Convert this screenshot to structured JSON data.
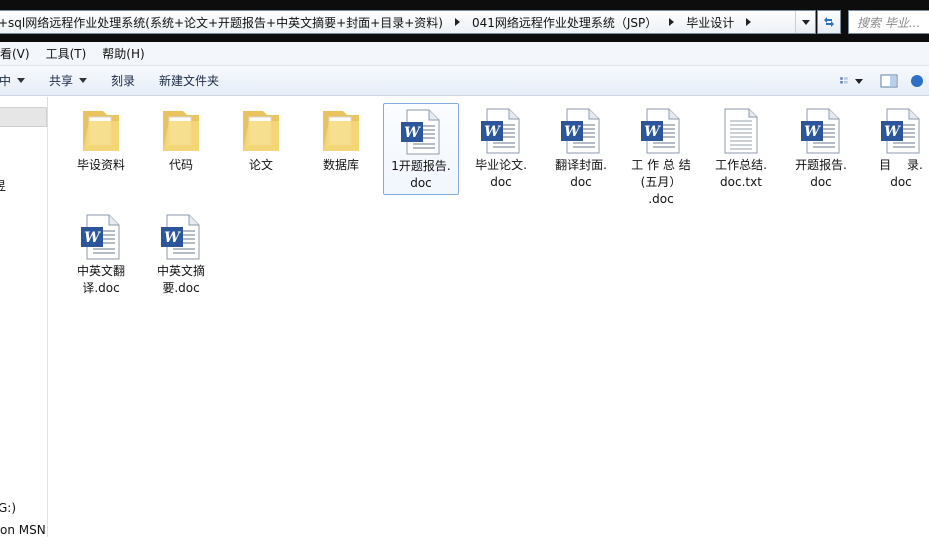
{
  "address": {
    "crumbs": [
      "+sql网络远程作业处理系统(系统+论文+开题报告+中英文摘要+封面+目录+资料)",
      "041网络远程作业处理系统（JSP）",
      "毕业设计"
    ]
  },
  "search": {
    "placeholder": "搜索 毕业..."
  },
  "menu": {
    "items": [
      "看(V)",
      "工具(T)",
      "帮助(H)"
    ]
  },
  "commands": {
    "include": "中",
    "share": "共享",
    "burn": "刻录",
    "new_folder": "新建文件夹"
  },
  "nav": {
    "partial": [
      "昱",
      "G:)",
      "on MSN"
    ]
  },
  "files": [
    {
      "line1": "毕设资料",
      "line2": "",
      "line3": "",
      "type": "folder"
    },
    {
      "line1": "代码",
      "line2": "",
      "line3": "",
      "type": "folder"
    },
    {
      "line1": "论文",
      "line2": "",
      "line3": "",
      "type": "folder"
    },
    {
      "line1": "数据库",
      "line2": "",
      "line3": "",
      "type": "folder"
    },
    {
      "line1": "1开题报告.",
      "line2": "doc",
      "line3": "",
      "type": "word",
      "selected": true
    },
    {
      "line1": "毕业论文.",
      "line2": "doc",
      "line3": "",
      "type": "word"
    },
    {
      "line1": "翻译封面.",
      "line2": "doc",
      "line3": "",
      "type": "word"
    },
    {
      "line1": "工 作 总 结",
      "line2": "(五月）",
      "line3": ".doc",
      "type": "word"
    },
    {
      "line1": "工作总结.",
      "line2": "doc.txt",
      "line3": "",
      "type": "text"
    },
    {
      "line1": "开题报告.",
      "line2": "doc",
      "line3": "",
      "type": "word"
    },
    {
      "line1": "目　 录.",
      "line2": "doc",
      "line3": "",
      "type": "word"
    },
    {
      "line1": "中英文翻",
      "line2": "译.doc",
      "line3": "",
      "type": "word"
    },
    {
      "line1": "中英文摘",
      "line2": "要.doc",
      "line3": "",
      "type": "word"
    }
  ]
}
